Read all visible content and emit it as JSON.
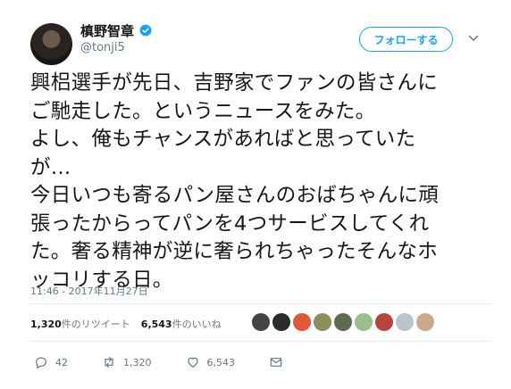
{
  "user": {
    "display_name": "槙野智章",
    "handle": "@tonji5"
  },
  "follow_button_label": "フォローする",
  "tweet": {
    "lines": [
      "興梠選手が先日、吉野家でファンの皆さんに",
      "ご馳走した。というニュースをみた。",
      "よし、俺もチャンスがあればと思っていた",
      "が…",
      "今日いつも寄るパン屋さんのおばちゃんに頑",
      "張ったからってパンを4つサービスしてくれ",
      "た。奢る精神が逆に奢られちゃったそんなホ",
      "ッコリする日。"
    ],
    "timestamp": "11:46 - 2017年11月27日"
  },
  "stats": {
    "retweets_count": "1,320",
    "retweets_label": "件のリツイート",
    "likes_count": "6,543",
    "likes_label": "件のいいね"
  },
  "actions": {
    "reply_count": "42",
    "retweet_count": "1,320",
    "like_count": "6,543"
  },
  "colors": {
    "accent": "#1da1f2",
    "muted": "#657786",
    "divider": "#e6ecf0"
  },
  "likers": [
    {
      "icon": "liker-avatar",
      "color": "#444444"
    },
    {
      "icon": "liker-avatar",
      "color": "#2b2b2b"
    },
    {
      "icon": "liker-avatar",
      "color": "#e0573a"
    },
    {
      "icon": "liker-avatar",
      "color": "#8c8f5a"
    },
    {
      "icon": "liker-avatar",
      "color": "#5d6b4f"
    },
    {
      "icon": "liker-avatar",
      "color": "#9bbf8a"
    },
    {
      "icon": "liker-avatar",
      "color": "#b7453f"
    },
    {
      "icon": "liker-avatar",
      "color": "#b9c4cc"
    },
    {
      "icon": "liker-avatar",
      "color": "#c9a98a"
    }
  ]
}
